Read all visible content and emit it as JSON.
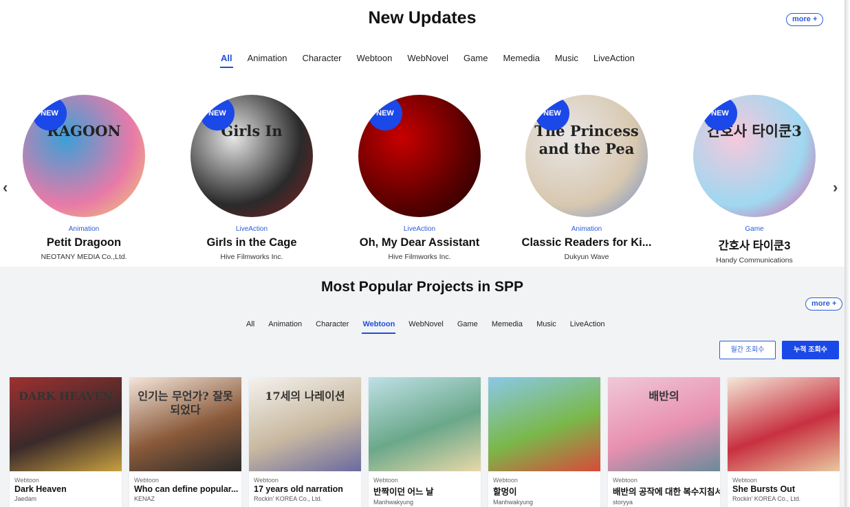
{
  "new_updates": {
    "title": "New Updates",
    "more_label": "more +",
    "tabs": [
      "All",
      "Animation",
      "Character",
      "Webtoon",
      "WebNovel",
      "Game",
      "Memedia",
      "Music",
      "LiveAction"
    ],
    "active_tab": "All",
    "prev_icon": "‹",
    "next_icon": "›",
    "badge_label": "NEW",
    "items": [
      {
        "category": "Animation",
        "title": "Petit Dragoon",
        "company": "NEOTANY MEDIA Co.,Ltd.",
        "art_text": "RAGOON",
        "palette": [
          "#3aa0d8",
          "#e87aa8",
          "#f3d36b"
        ]
      },
      {
        "category": "LiveAction",
        "title": "Girls in the Cage",
        "company": "Hive Filmworks Inc.",
        "art_text": "Girls In",
        "palette": [
          "#e6e6e6",
          "#2a2a2a",
          "#8a2020"
        ]
      },
      {
        "category": "LiveAction",
        "title": "Oh, My Dear Assistant",
        "company": "Hive Filmworks Inc.",
        "art_text": "",
        "palette": [
          "#c80000",
          "#5a0000",
          "#1a0000"
        ]
      },
      {
        "category": "Animation",
        "title": "Classic Readers for Ki...",
        "company": "Dukyun Wave",
        "art_text": "The Princess and the Pea",
        "palette": [
          "#e8e6e6",
          "#d8c8b0",
          "#6a8cc8"
        ]
      },
      {
        "category": "Game",
        "title": "간호사 타이쿤3",
        "company": "Handy Communications",
        "art_text": "간호사 타이쿤3",
        "palette": [
          "#f6c8dc",
          "#9fd8f0",
          "#e04f9a"
        ]
      }
    ]
  },
  "popular": {
    "title": "Most Popular Projects in SPP",
    "more_label": "more +",
    "tabs": [
      "All",
      "Animation",
      "Character",
      "Webtoon",
      "WebNovel",
      "Game",
      "Memedia",
      "Music",
      "LiveAction"
    ],
    "active_tab": "Webtoon",
    "sort_monthly": "월간 조회수",
    "sort_total": "누적 조회수",
    "items": [
      {
        "category": "Webtoon",
        "title": "Dark Heaven",
        "company": "Jaedam",
        "art_text": "DARK HEAVEN",
        "palette": [
          "#a03030",
          "#3a2a2a",
          "#c8a040"
        ]
      },
      {
        "category": "Webtoon",
        "title": "Who can define popular...",
        "company": "KENAZ",
        "art_text": "인기는 무언가? 잘못되었다",
        "palette": [
          "#f4e6dc",
          "#8a5a3a",
          "#2a2a2a"
        ]
      },
      {
        "category": "Webtoon",
        "title": "17 years old narration",
        "company": "Rockin' KOREA Co., Ltd.",
        "art_text": "17세의 나레이션",
        "palette": [
          "#f4f2ee",
          "#c8b8a0",
          "#6a6aa0"
        ]
      },
      {
        "category": "Webtoon",
        "title": "반짝이던 어느 날",
        "company": "Manhwakyung",
        "art_text": "",
        "palette": [
          "#bfe0e6",
          "#6aa88a",
          "#e8d8a8"
        ]
      },
      {
        "category": "Webtoon",
        "title": "할멍이",
        "company": "Manhwakyung",
        "art_text": "",
        "palette": [
          "#8ac8e8",
          "#7ab84a",
          "#d84a3a"
        ]
      },
      {
        "category": "Webtoon",
        "title": "배반의 공작에 대한 복수지침서",
        "company": "storyya",
        "art_text": "배반의",
        "palette": [
          "#f0c8d8",
          "#e890b0",
          "#6a8a9a"
        ]
      },
      {
        "category": "Webtoon",
        "title": "She Bursts Out",
        "company": "Rockin' KOREA Co., Ltd.",
        "art_text": "",
        "palette": [
          "#f4e8d8",
          "#c83040",
          "#e8c8a0"
        ]
      }
    ]
  }
}
